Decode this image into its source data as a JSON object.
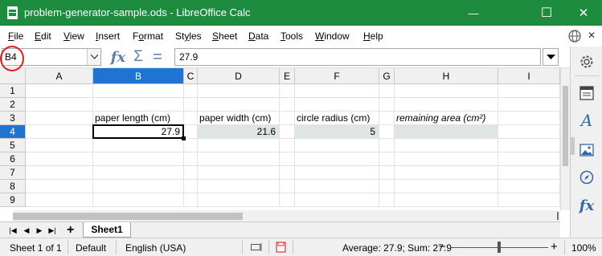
{
  "window": {
    "title": "problem-generator-sample.ods - LibreOffice Calc",
    "minimize_glyph": "—",
    "maximize_glyph": "☐",
    "close_glyph": "✕",
    "icons": [
      "libreoffice-calc-icon",
      "minimize-icon",
      "maximize-icon",
      "close-icon"
    ]
  },
  "menu": {
    "items": [
      {
        "key": "F",
        "rest": "ile"
      },
      {
        "key": "E",
        "rest": "dit"
      },
      {
        "key": "V",
        "rest": "iew"
      },
      {
        "key": "I",
        "rest": "nsert"
      },
      {
        "key": "o",
        "pre": "F",
        "rest": "rmat"
      },
      {
        "key": "y",
        "pre": "St",
        "rest": "les"
      },
      {
        "key": "S",
        "rest": "heet"
      },
      {
        "key": "D",
        "rest": "ata"
      },
      {
        "key": "T",
        "rest": "ools"
      },
      {
        "key": "W",
        "rest": "indow"
      },
      {
        "key": "H",
        "rest": "elp"
      }
    ],
    "close_doc_glyph": "✕"
  },
  "formula_bar": {
    "name_box": "B4",
    "function_wizard": "fx",
    "sum_glyph": "Σ",
    "equals_glyph": "=",
    "content": "27.9"
  },
  "columns": [
    "A",
    "B",
    "C",
    "D",
    "E",
    "F",
    "G",
    "H",
    "I"
  ],
  "rows": [
    "1",
    "2",
    "3",
    "4",
    "5",
    "6",
    "7",
    "8",
    "9"
  ],
  "selected_column": "B",
  "selected_row": "4",
  "cells": {
    "B3": "paper length (cm)",
    "D3": "paper width (cm)",
    "F3": "circle radius (cm)",
    "H3": "remaining area (cm²)",
    "B4": "27.9",
    "D4": "21.6",
    "F4": "5",
    "H4": ""
  },
  "sheet_tabs": {
    "add_glyph": "+",
    "tabs": [
      "Sheet1"
    ]
  },
  "status_bar": {
    "sheet_info": "Sheet 1 of 1",
    "page_style": "Default",
    "language": "English (USA)",
    "selection_summary": "Average: 27.9; Sum: 27.9",
    "zoom_minus": "−",
    "zoom_plus": "+",
    "zoom": "100%",
    "zoom_level_fraction": 0.5
  },
  "sidebar": {
    "buttons": [
      "settings-icon",
      "properties-icon",
      "styles-icon",
      "gallery-icon",
      "navigator-icon",
      "functions-icon"
    ],
    "functions_label": "fx"
  },
  "colors": {
    "titlebar": "#1e8c3e",
    "selection": "#1e74d0",
    "shaded_cells": "#dfe5e0",
    "highlight_ring": "#e02020"
  }
}
